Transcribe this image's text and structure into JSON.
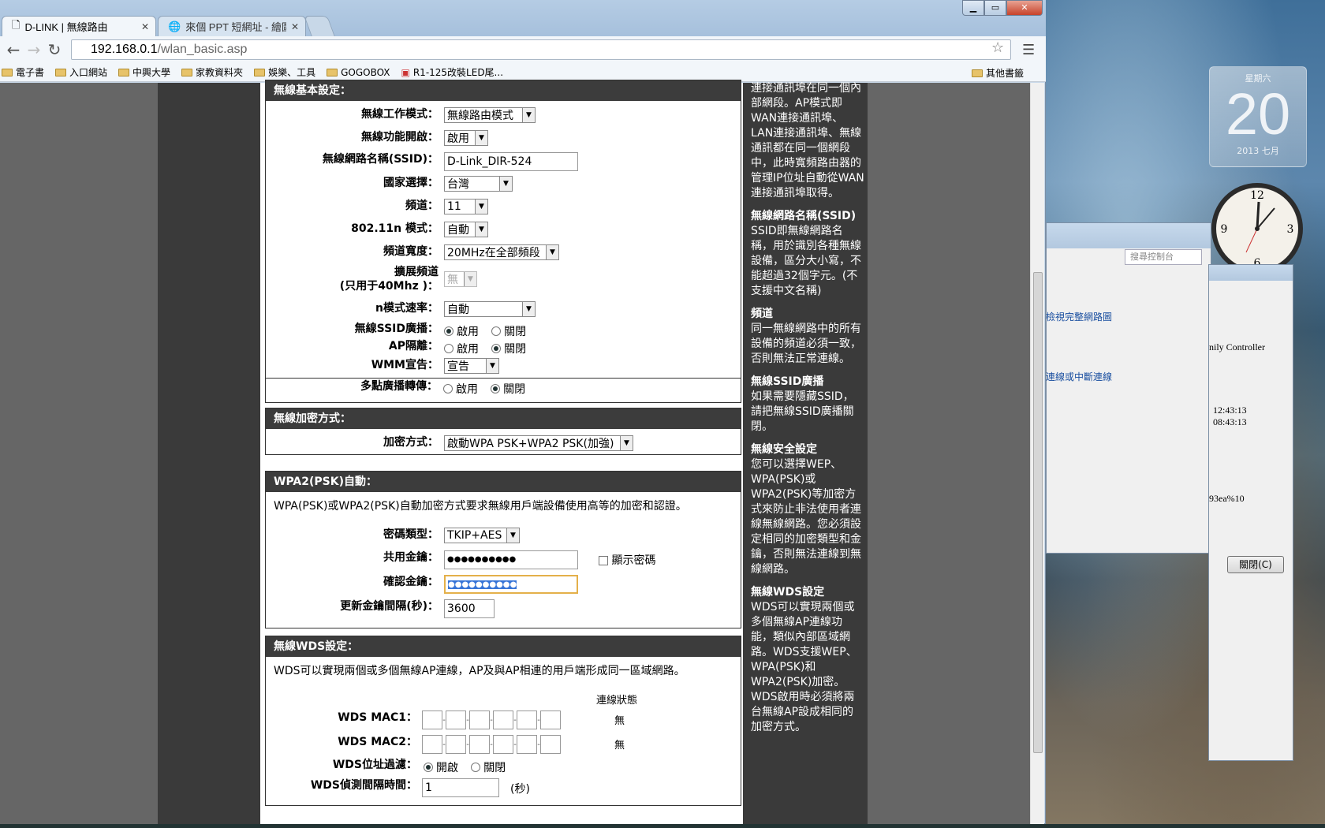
{
  "browser": {
    "tabs": [
      {
        "title": "D-LINK | 無線路由",
        "active": true
      },
      {
        "title": "來個 PPT 短網址 - 繪圖剪",
        "active": false
      }
    ],
    "url_host": "192.168.0.1",
    "url_path": "/wlan_basic.asp",
    "bookmarks": [
      "電子書",
      "入口網站",
      "中興大學",
      "家教資料夾",
      "娛樂、工具",
      "GOGOBOX",
      "R1-125改裝LED尾..."
    ],
    "other_bookmarks": "其他書籤"
  },
  "basic": {
    "title": "無線基本設定：",
    "mode_label": "無線工作模式：",
    "mode_value": "無線路由模式",
    "enable_label": "無線功能開啟：",
    "enable_value": "啟用",
    "ssid_label": "無線網路名稱(SSID)：",
    "ssid_value": "D-Link_DIR-524",
    "country_label": "國家選擇：",
    "country_value": "台灣",
    "channel_label": "頻道：",
    "channel_value": "11",
    "n_mode_label": "802.11n 模式：",
    "n_mode_value": "自動",
    "bandwidth_label": "頻道寬度：",
    "bandwidth_value": "20MHz在全部頻段",
    "ext_channel_label_1": "擴展頻道",
    "ext_channel_label_2": "(只用于40Mhz )：",
    "ext_channel_value": "無",
    "n_rate_label": "n模式速率：",
    "n_rate_value": "自動",
    "ssid_broadcast_label": "無線SSID廣播：",
    "ap_isolation_label": "AP隔離：",
    "wmm_label": "WMM宣告：",
    "wmm_value": "宣告",
    "multicast_label": "多點廣播轉傳：",
    "enable_opt": "啟用",
    "disable_opt": "關閉"
  },
  "security": {
    "title": "無線加密方式：",
    "method_label": "加密方式：",
    "method_value": "啟動WPA PSK+WPA2 PSK(加強)"
  },
  "wpa": {
    "title": "WPA2(PSK)自動：",
    "note": "WPA(PSK)或WPA2(PSK)自動加密方式要求無線用戶端設備使用高等的加密和認證。",
    "cipher_label": "密碼類型：",
    "cipher_value": "TKIP+AES",
    "key_label": "共用金鑰：",
    "key_value": "●●●●●●●●●●",
    "show_password": "顯示密碼",
    "confirm_label": "確認金鑰：",
    "confirm_value": "●●●●●●●●●●",
    "interval_label": "更新金鑰間隔(秒)：",
    "interval_value": "3600"
  },
  "wds": {
    "title": "無線WDS設定：",
    "note": "WDS可以實現兩個或多個無線AP連線，AP及與AP相連的用戶端形成同一區域網路。",
    "status_header": "連線狀態",
    "mac1_label": "WDS MAC1：",
    "mac1_status": "無",
    "mac2_label": "WDS MAC2：",
    "mac2_status": "無",
    "filter_label": "WDS位址過濾：",
    "filter_on": "開啟",
    "filter_off": "關閉",
    "detect_label": "WDS偵測間隔時間：",
    "detect_value": "1",
    "detect_unit": "(秒)"
  },
  "help": [
    {
      "title": "",
      "text": "連接通訊埠在同一個內部網段。AP模式即WAN連接通訊埠、LAN連接通訊埠、無線通訊都在同一個網段中，此時寬頻路由器的管理IP位址自動從WAN連接通訊埠取得。"
    },
    {
      "title": "無線網路名稱(SSID)",
      "text": "SSID即無線網路名稱，用於識別各種無線設備，區分大小寫，不能超過32個字元。(不支援中文名稱)"
    },
    {
      "title": "頻道",
      "text": "同一無線網路中的所有設備的頻道必須一致，否則無法正常連線。"
    },
    {
      "title": "無線SSID廣播",
      "text": "如果需要隱藏SSID，請把無線SSID廣播關閉。"
    },
    {
      "title": "無線安全設定",
      "text": "您可以選擇WEP、WPA(PSK)或WPA2(PSK)等加密方式來防止非法使用者連線無線網路。您必須設定相同的加密類型和金鑰，否則無法連線到無線網路。"
    },
    {
      "title": "無線WDS設定",
      "text": "WDS可以實現兩個或多個無線AP連線功能，類似內部區域網路。WDS支援WEP、WPA(PSK)和WPA2(PSK)加密。WDS啟用時必須將兩台無線AP設成相同的加密方式。"
    }
  ],
  "desktop": {
    "cal_dow": "星期六",
    "cal_day": "20",
    "cal_month": "2013 七月",
    "search_placeholder": "搜尋控制台",
    "w2_link1": "檢視完整網路圖",
    "w2_link2": "連線或中斷連線",
    "w3_text1": "nily Controller",
    "w3_time1": "12:43:13",
    "w3_time2": "08:43:13",
    "w3_text2": "93ea%10",
    "close_button": "關閉(C)"
  }
}
